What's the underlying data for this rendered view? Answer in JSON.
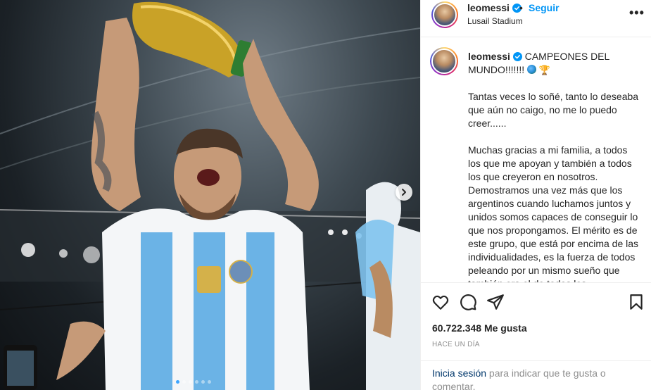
{
  "post": {
    "username": "leomessi",
    "follow_label": "Seguir",
    "separator": "•",
    "location": "Lusail Stadium",
    "more_label": "•••",
    "caption": {
      "title": "CAMPEONES DEL MUNDO!!!!!!!",
      "paragraphs": [
        "Tantas veces lo soñé, tanto lo deseaba que aún no caigo, no me lo puedo creer......",
        "Muchas gracias a mi familia, a todos los que me apoyan y también a todos los que creyeron en nosotros. Demostramos una vez más que los argentinos cuando luchamos juntos y unidos somos capaces de conseguir lo que nos propongamos. El mérito es de este grupo, que está por encima de las individualidades, es la fuerza de todos peleando por un mismo sueño que también era el de todos los"
      ]
    },
    "likes": "60.722.348 Me gusta",
    "time_ago": "HACE UN DÍA",
    "login_link": "Inicia sesión",
    "login_rest": " para indicar que te gusta o comentar."
  },
  "icons": {
    "verified": "verified-badge-icon",
    "like": "heart-icon",
    "comment": "comment-icon",
    "share": "share-icon",
    "save": "bookmark-icon",
    "next": "chevron-right-icon"
  },
  "colors": {
    "link": "#0095f6",
    "login_link": "#00376b",
    "muted": "#8e8e8e",
    "text": "#262626"
  },
  "carousel": {
    "slides": 6,
    "active": 1
  }
}
